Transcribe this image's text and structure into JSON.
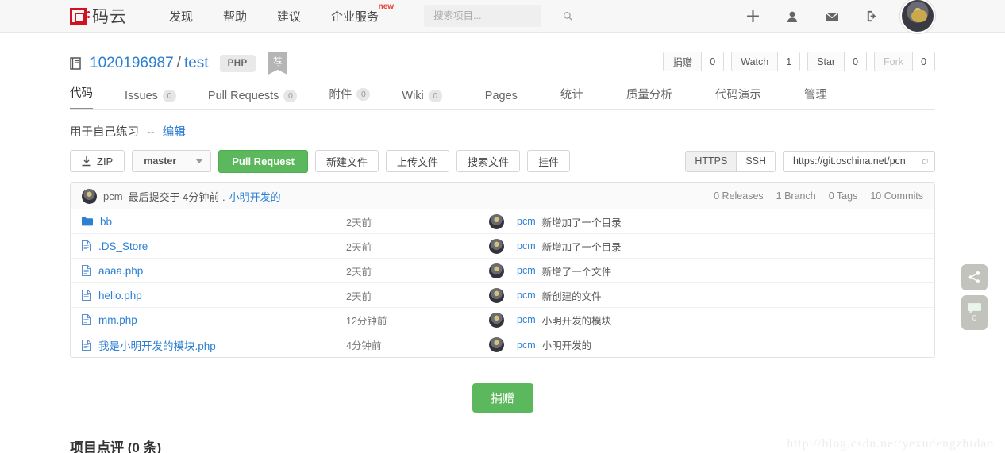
{
  "topnav": {
    "brand": "码云",
    "links": [
      {
        "label": "发现",
        "badge": ""
      },
      {
        "label": "帮助",
        "badge": ""
      },
      {
        "label": "建议",
        "badge": ""
      },
      {
        "label": "企业服务",
        "badge": "new"
      }
    ],
    "search": {
      "placeholder": "搜索项目...",
      "value": ""
    },
    "icons": [
      "plus-icon",
      "user-icon",
      "envelope-icon",
      "logout-icon",
      "avatar"
    ]
  },
  "repo": {
    "owner": "1020196987",
    "separator": "/",
    "name": "test",
    "language": "PHP",
    "recommend_badge": "荐",
    "counters": [
      {
        "label": "捐赠",
        "count": "0",
        "dim": false
      },
      {
        "label": "Watch",
        "count": "1",
        "dim": false
      },
      {
        "label": "Star",
        "count": "0",
        "dim": false
      },
      {
        "label": "Fork",
        "count": "0",
        "dim": true
      }
    ]
  },
  "tabs": [
    {
      "label": "代码",
      "count": "",
      "active": true
    },
    {
      "label": "Issues",
      "count": "0",
      "active": false
    },
    {
      "label": "Pull Requests",
      "count": "0",
      "active": false
    },
    {
      "label": "附件",
      "count": "0",
      "active": false
    },
    {
      "label": "Wiki",
      "count": "0",
      "active": false
    },
    {
      "label": "Pages",
      "count": "",
      "active": false
    },
    {
      "label": "统计",
      "count": "",
      "active": false
    },
    {
      "label": "质量分析",
      "count": "",
      "active": false
    },
    {
      "label": "代码演示",
      "count": "",
      "active": false
    },
    {
      "label": "管理",
      "count": "",
      "active": false
    }
  ],
  "description": {
    "text": "用于自己练习",
    "dashes": "--",
    "edit_label": "编辑"
  },
  "toolbar": {
    "zip_label": "ZIP",
    "branch_label": "master",
    "pull_request_label": "Pull Request",
    "new_file_label": "新建文件",
    "upload_file_label": "上传文件",
    "search_file_label": "搜索文件",
    "widget_label": "挂件",
    "protocol_https": "HTTPS",
    "protocol_ssh": "SSH",
    "clone_url": "https://git.oschina.net/pcn"
  },
  "commit_bar": {
    "user": "pcm",
    "text": "最后提交于 4分钟前 .",
    "message": "小明开发的",
    "stats": [
      "0 Releases",
      "1 Branch",
      "0 Tags",
      "10 Commits"
    ]
  },
  "files": [
    {
      "name": "bb",
      "type": "folder",
      "time": "2天前",
      "user": "pcm",
      "message": "新增加了一个目录"
    },
    {
      "name": ".DS_Store",
      "type": "file",
      "time": "2天前",
      "user": "pcm",
      "message": "新增加了一个目录"
    },
    {
      "name": "aaaa.php",
      "type": "file",
      "time": "2天前",
      "user": "pcm",
      "message": "新增了一个文件"
    },
    {
      "name": "hello.php",
      "type": "file",
      "time": "2天前",
      "user": "pcm",
      "message": "新创建的文件"
    },
    {
      "name": "mm.php",
      "type": "file",
      "time": "12分钟前",
      "user": "pcm",
      "message": "小明开发的模块"
    },
    {
      "name": "我是小明开发的模块.php",
      "type": "file",
      "time": "4分钟前",
      "user": "pcm",
      "message": "小明开发的"
    }
  ],
  "donate": {
    "label": "捐赠"
  },
  "comments": {
    "title": "项目点评 (0 条)"
  },
  "rail": {
    "share_icon": "share-icon",
    "comment_icon": "comment-icon",
    "comment_count": "0"
  },
  "watermark": "http://blog.csdn.net/yexudengzhidao",
  "colors": {
    "brand_red": "#cf1322",
    "link_blue": "#2b7fd4",
    "green": "#5cb85c",
    "nav_bg": "#f7f7f7"
  }
}
